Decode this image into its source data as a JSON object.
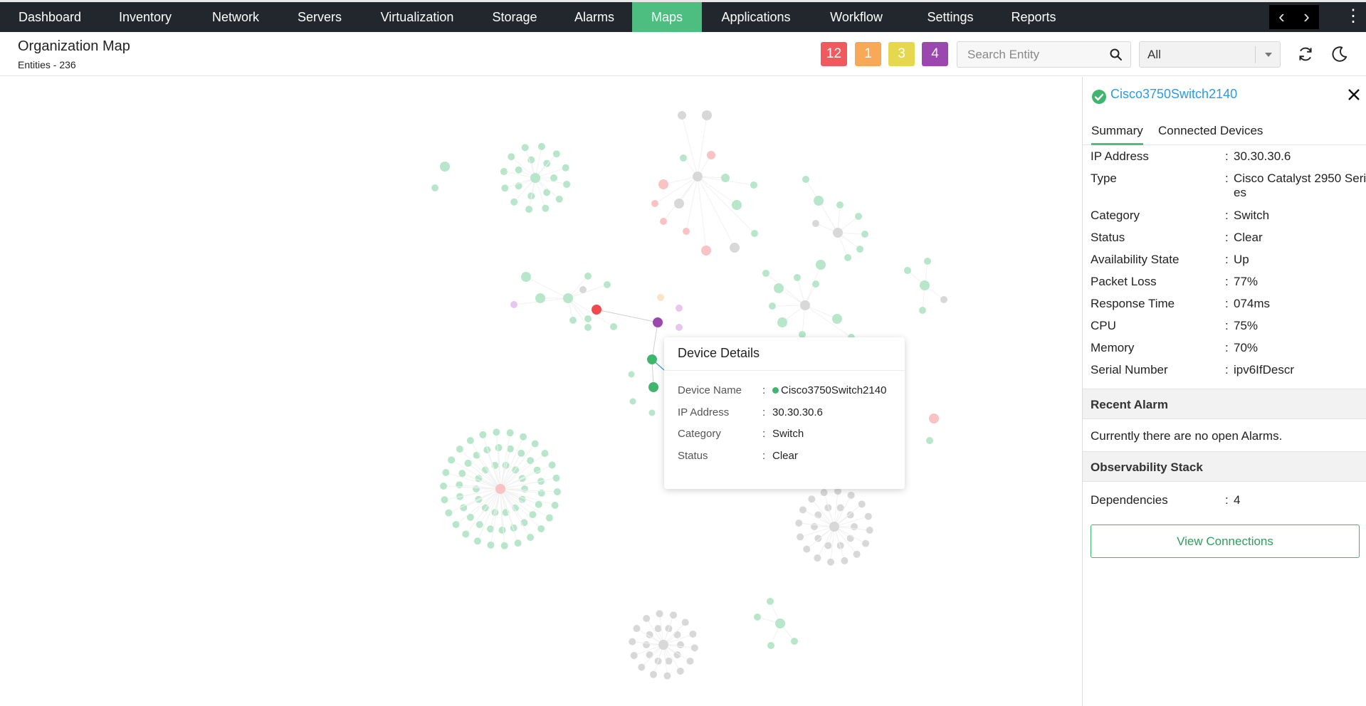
{
  "nav": {
    "items": [
      "Dashboard",
      "Inventory",
      "Network",
      "Servers",
      "Virtualization",
      "Storage",
      "Alarms",
      "Maps",
      "Applications",
      "Workflow",
      "Settings",
      "Reports"
    ],
    "active": "Maps",
    "icons": {
      "prev": "chevron-left-icon",
      "next": "chevron-right-icon",
      "more": "kebab-menu-icon"
    }
  },
  "header": {
    "title": "Organization Map",
    "subtitle": "Entities - 236",
    "badges": [
      {
        "count": "12",
        "color": "#f05a5e"
      },
      {
        "count": "1",
        "color": "#f8a957"
      },
      {
        "count": "3",
        "color": "#e5d84f"
      },
      {
        "count": "4",
        "color": "#9c46b0"
      }
    ],
    "search_placeholder": "Search Entity",
    "filter_value": "All",
    "icons": {
      "search": "search-icon",
      "refresh": "refresh-icon",
      "theme": "moon-icon"
    }
  },
  "tooltip": {
    "title": "Device Details",
    "rows": [
      {
        "label": "Device Name",
        "value": "Cisco3750Switch2140"
      },
      {
        "label": "IP Address",
        "value": "30.30.30.6"
      },
      {
        "label": "Category",
        "value": "Switch"
      },
      {
        "label": "Status",
        "value": "Clear"
      }
    ]
  },
  "panel": {
    "device_name": "Cisco3750Switch2140",
    "tabs": [
      "Summary",
      "Connected Devices"
    ],
    "active_tab": "Summary",
    "properties": [
      {
        "label": "IP Address",
        "value": "30.30.30.6"
      },
      {
        "label": "Type",
        "value": "Cisco Catalyst 2950 Series"
      },
      {
        "label": "Category",
        "value": "Switch"
      },
      {
        "label": "Status",
        "value": "Clear"
      },
      {
        "label": "Availability State",
        "value": "Up"
      },
      {
        "label": "Packet Loss",
        "value": "77%"
      },
      {
        "label": "Response Time",
        "value": "074ms"
      },
      {
        "label": "CPU",
        "value": "75%"
      },
      {
        "label": "Memory",
        "value": "70%"
      },
      {
        "label": "Serial Number",
        "value": "ipv6IfDescr"
      }
    ],
    "recent_alarm_title": "Recent Alarm",
    "recent_alarm_text": "Currently there are no open Alarms.",
    "observability_title": "Observability Stack",
    "dependencies_label": "Dependencies",
    "dependencies_value": "4",
    "view_connections": "View Connections"
  },
  "colors": {
    "accent": "#4dbd80",
    "node_clear": "#3fb56d",
    "node_critical": "#ef4b4f",
    "node_attention": "#9c46b0",
    "node_unknown": "#9e9e9e",
    "link": "#2d9be0"
  }
}
